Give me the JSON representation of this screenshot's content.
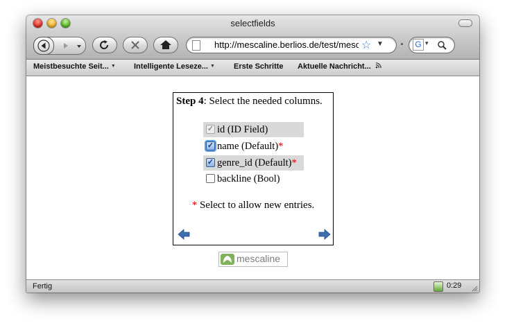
{
  "window": {
    "title": "selectfields"
  },
  "toolbar": {
    "url": "http://mescaline.berlios.de/test/mesc",
    "search_engine": "G",
    "icons": [
      "back-icon",
      "forward-icon",
      "reload-icon",
      "stop-icon",
      "home-icon",
      "bookmark-star-icon",
      "search-icon"
    ]
  },
  "bookmarks": [
    {
      "label": "Meistbesuchte Seit...",
      "has_menu": true
    },
    {
      "label": "Intelligente Leseze...",
      "has_menu": true
    },
    {
      "label": "Erste Schritte",
      "has_menu": false
    },
    {
      "label": "Aktuelle Nachricht...",
      "has_menu": false,
      "rss": true
    }
  ],
  "wizard": {
    "step_label": "Step 4",
    "step_text": ": Select the needed columns.",
    "fields": [
      {
        "label": "id (ID Field)",
        "required": false,
        "checked": true,
        "disabled": true,
        "highlighted": true
      },
      {
        "label": "name (Default)",
        "required": true,
        "checked": true,
        "disabled": false,
        "highlighted": false,
        "focused": true
      },
      {
        "label": "genre_id (Default)",
        "required": true,
        "checked": true,
        "disabled": false,
        "highlighted": true
      },
      {
        "label": "backline (Bool)",
        "required": false,
        "checked": false,
        "disabled": false,
        "highlighted": false
      }
    ],
    "required_marker": "*",
    "note": " Select to allow new entries.",
    "nav": {
      "prev": "arrow-left-icon",
      "next": "arrow-right-icon"
    }
  },
  "logo": {
    "text": "mescaline"
  },
  "status": {
    "text": "Fertig",
    "time": "0:29"
  },
  "colors": {
    "required": "#d10000",
    "highlight": "#d9d9d9",
    "nav_arrow": "#3f6fb0"
  }
}
